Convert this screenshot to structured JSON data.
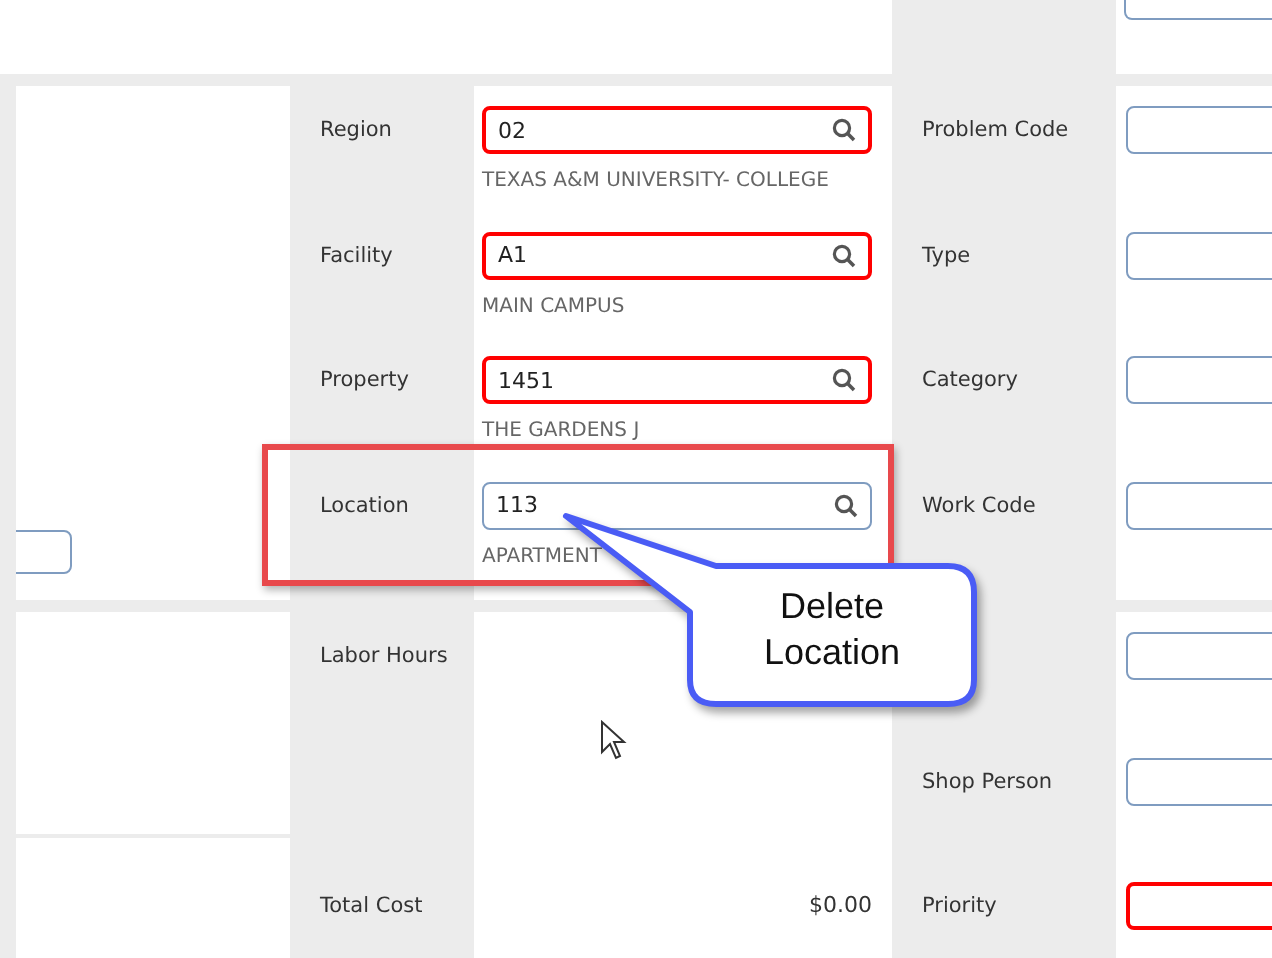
{
  "location_fields": [
    {
      "label": "Region",
      "value": "02",
      "required": true,
      "description": "TEXAS A&M UNIVERSITY- COLLEGE"
    },
    {
      "label": "Facility",
      "value": "A1",
      "required": true,
      "description": "MAIN CAMPUS"
    },
    {
      "label": "Property",
      "value": "1451",
      "required": true,
      "description": "THE GARDENS J"
    },
    {
      "label": "Location",
      "value": "113",
      "required": false,
      "description": "APARTMENT"
    }
  ],
  "classification_fields": [
    {
      "label": "Problem Code",
      "required": false
    },
    {
      "label": "Type",
      "required": false
    },
    {
      "label": "Category",
      "required": false
    },
    {
      "label": "Work Code",
      "required": false
    }
  ],
  "cost_fields": [
    {
      "label": "Labor Hours"
    },
    {
      "label": "Total Cost",
      "value": "$0.00"
    }
  ],
  "assignment_fields": [
    {
      "required": false
    },
    {
      "label": "Shop Person",
      "required": false
    },
    {
      "label": "Priority",
      "required": true
    }
  ],
  "callout": {
    "lines": [
      "Delete",
      "Location"
    ]
  }
}
